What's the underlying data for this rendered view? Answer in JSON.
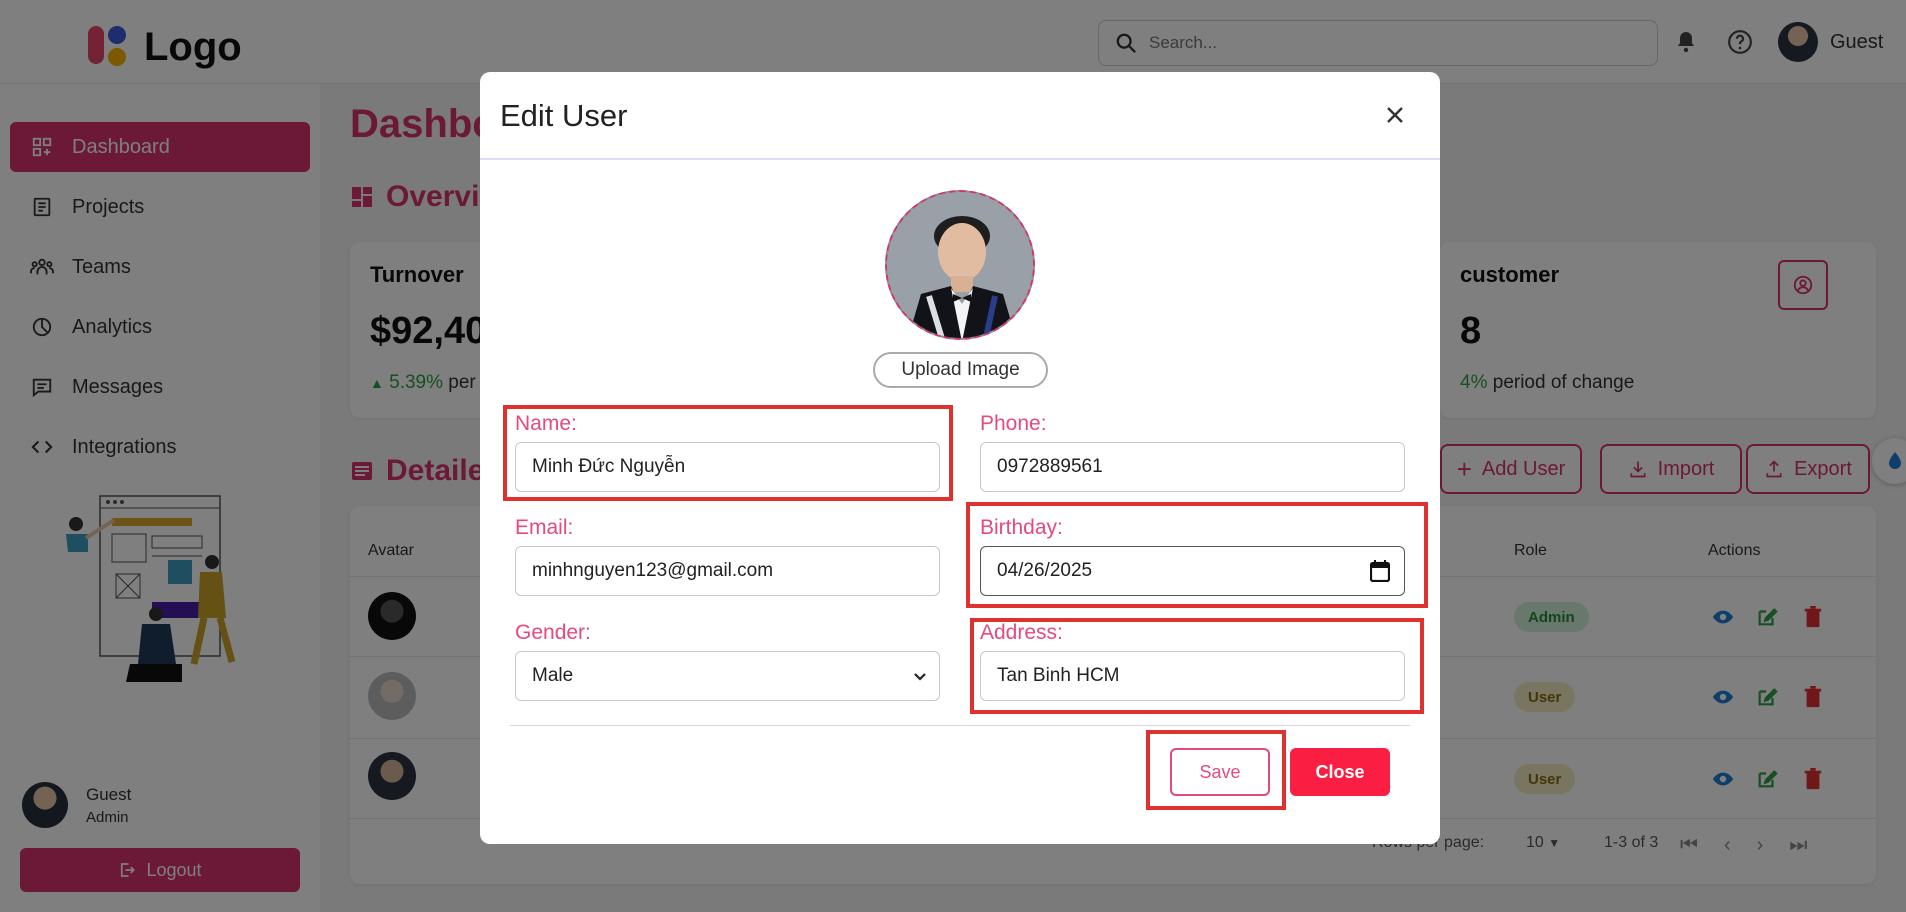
{
  "topbar": {
    "logo_text": "Logo",
    "search_placeholder": "Search...",
    "user_name": "Guest"
  },
  "sidebar": {
    "items": [
      {
        "label": "Dashboard",
        "icon": "dashboard-icon",
        "active": true
      },
      {
        "label": "Projects",
        "icon": "projects-icon"
      },
      {
        "label": "Teams",
        "icon": "teams-icon"
      },
      {
        "label": "Analytics",
        "icon": "analytics-icon"
      },
      {
        "label": "Messages",
        "icon": "messages-icon"
      },
      {
        "label": "Integrations",
        "icon": "code-icon"
      }
    ],
    "user_name": "Guest",
    "user_role": "Admin",
    "logout_label": "Logout"
  },
  "main": {
    "title": "Dashbo",
    "overview_title": "Overvi",
    "cards": [
      {
        "label": "Turnover",
        "value": "$92,40",
        "change_pct": "5.39%",
        "change_text": "per"
      },
      {
        "label": "customer",
        "value": "8",
        "change_pct": "4%",
        "change_text": "period of change"
      }
    ],
    "details_title": "Detaile",
    "actions": {
      "add_user": "Add User",
      "import": "Import",
      "export": "Export"
    },
    "table": {
      "headers": {
        "avatar": "Avatar",
        "role": "Role",
        "actions": "Actions"
      },
      "rows": [
        {
          "role": "Admin"
        },
        {
          "role": "User"
        },
        {
          "role": "User"
        }
      ],
      "rows_per_page_label": "Rows per page:",
      "rows_per_page_value": "10",
      "range": "1-3 of 3"
    }
  },
  "modal": {
    "title": "Edit User",
    "upload_label": "Upload Image",
    "fields": {
      "name": {
        "label": "Name:",
        "value": "Minh Đức Nguyễn"
      },
      "phone": {
        "label": "Phone:",
        "value": "0972889561"
      },
      "email": {
        "label": "Email:",
        "value": "minhnguyen123@gmail.com"
      },
      "birthday": {
        "label": "Birthday:",
        "value": "04/26/2025"
      },
      "gender": {
        "label": "Gender:",
        "value": "Male"
      },
      "address": {
        "label": "Address:",
        "value": "Tan Binh HCM"
      }
    },
    "save_label": "Save",
    "close_label": "Close"
  },
  "colors": {
    "accent": "#d6336c",
    "label_pink": "#e64980",
    "close_red": "#fa1e42",
    "highlight_red": "#e03131",
    "positive_green": "#2f9e44"
  }
}
